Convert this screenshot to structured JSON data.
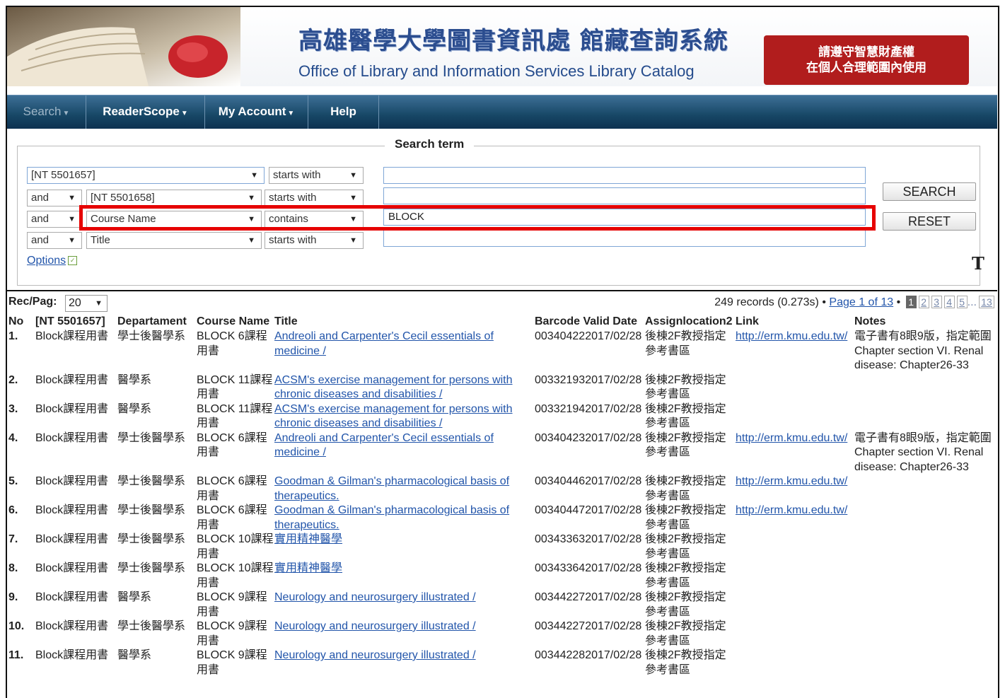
{
  "header": {
    "title_cn": "高雄醫學大學圖書資訊處 館藏查詢系統",
    "title_en": "Office of Library and Information Services  Library Catalog",
    "notice_line1": "請遵守智慧財產權",
    "notice_line2": "在個人合理範圍內使用"
  },
  "nav": {
    "search": "Search",
    "readerscope": "ReaderScope",
    "my_account": "My Account",
    "help": "Help"
  },
  "search": {
    "legend": "Search term",
    "rows": [
      {
        "bool": "",
        "field": "[NT 5501657]",
        "op": "starts with",
        "value": ""
      },
      {
        "bool": "and",
        "field": "[NT 5501658]",
        "op": "starts with",
        "value": ""
      },
      {
        "bool": "and",
        "field": "Course Name",
        "op": "contains",
        "value": "BLOCK"
      },
      {
        "bool": "and",
        "field": "Title",
        "op": "starts with",
        "value": ""
      }
    ],
    "search_button": "SEARCH",
    "reset_button": "RESET",
    "options": "Options",
    "t_icon": "T"
  },
  "results": {
    "rec_label": "Rec/Pag:",
    "rec_value": "20",
    "summary": "249 records (0.273s) •",
    "page_link": "Page 1 of 13",
    "bullet": "•",
    "pages": [
      "1",
      "2",
      "3",
      "4",
      "5"
    ],
    "ellipsis": "...",
    "last_page": "13",
    "columns": [
      "No",
      "[NT 5501657]",
      "Departament",
      "Course Name",
      "Title",
      "Barcode",
      "Valid Date",
      "Assign",
      "location2",
      "Link",
      "Notes"
    ],
    "rows": [
      {
        "no": "1.",
        "nt": "Block課程用書",
        "dep": "學士後醫學系",
        "cn": "BLOCK 6課程用書",
        "title": "Andreoli and Carpenter's Cecil essentials of medicine /",
        "barcode_date": "003404222017/02/28",
        "loc": "後棟2F教授指定參考書區",
        "link": "http://erm.kmu.edu.tw/",
        "notes": "電子書有8眼9版，指定範圍Chapter section VI. Renal disease: Chapter26-33"
      },
      {
        "no": "2.",
        "nt": "Block課程用書",
        "dep": "醫學系",
        "cn": "BLOCK 11課程用書",
        "title": "ACSM's exercise management for persons with chronic diseases and disabilities /",
        "barcode_date": "003321932017/02/28",
        "loc": "後棟2F教授指定參考書區",
        "link": "",
        "notes": ""
      },
      {
        "no": "3.",
        "nt": "Block課程用書",
        "dep": "醫學系",
        "cn": "BLOCK 11課程用書",
        "title": "ACSM's exercise management for persons with chronic diseases and disabilities /",
        "barcode_date": "003321942017/02/28",
        "loc": "後棟2F教授指定參考書區",
        "link": "",
        "notes": ""
      },
      {
        "no": "4.",
        "nt": "Block課程用書",
        "dep": "學士後醫學系",
        "cn": "BLOCK 6課程用書",
        "title": "Andreoli and Carpenter's Cecil essentials of medicine /",
        "barcode_date": "003404232017/02/28",
        "loc": "後棟2F教授指定參考書區",
        "link": "http://erm.kmu.edu.tw/",
        "notes": "電子書有8眼9版，指定範圍Chapter section VI. Renal disease: Chapter26-33"
      },
      {
        "no": "5.",
        "nt": "Block課程用書",
        "dep": "學士後醫學系",
        "cn": "BLOCK 6課程用書",
        "title": "Goodman & Gilman's pharmacological basis of therapeutics.",
        "barcode_date": "003404462017/02/28",
        "loc": "後棟2F教授指定參考書區",
        "link": "http://erm.kmu.edu.tw/",
        "notes": ""
      },
      {
        "no": "6.",
        "nt": "Block課程用書",
        "dep": "學士後醫學系",
        "cn": "BLOCK 6課程用書",
        "title": "Goodman & Gilman's pharmacological basis of therapeutics.",
        "barcode_date": "003404472017/02/28",
        "loc": "後棟2F教授指定參考書區",
        "link": "http://erm.kmu.edu.tw/",
        "notes": ""
      },
      {
        "no": "7.",
        "nt": "Block課程用書",
        "dep": "學士後醫學系",
        "cn": "BLOCK 10課程用書",
        "title": "實用精神醫學",
        "barcode_date": "003433632017/02/28",
        "loc": "後棟2F教授指定參考書區",
        "link": "",
        "notes": ""
      },
      {
        "no": "8.",
        "nt": "Block課程用書",
        "dep": "學士後醫學系",
        "cn": "BLOCK 10課程用書",
        "title": "實用精神醫學",
        "barcode_date": "003433642017/02/28",
        "loc": "後棟2F教授指定參考書區",
        "link": "",
        "notes": ""
      },
      {
        "no": "9.",
        "nt": "Block課程用書",
        "dep": "醫學系",
        "cn": "BLOCK 9課程用書",
        "title": "Neurology and neurosurgery illustrated /",
        "barcode_date": "003442272017/02/28",
        "loc": "後棟2F教授指定參考書區",
        "link": "",
        "notes": ""
      },
      {
        "no": "10.",
        "nt": "Block課程用書",
        "dep": "學士後醫學系",
        "cn": "BLOCK 9課程用書",
        "title": "Neurology and neurosurgery illustrated /",
        "barcode_date": "003442272017/02/28",
        "loc": "後棟2F教授指定參考書區",
        "link": "",
        "notes": ""
      },
      {
        "no": "11.",
        "nt": "Block課程用書",
        "dep": "醫學系",
        "cn": "BLOCK 9課程用書",
        "title": "Neurology and neurosurgery illustrated /",
        "barcode_date": "003442282017/02/28",
        "loc": "後棟2F教授指定參考書區",
        "link": "",
        "notes": ""
      }
    ]
  }
}
